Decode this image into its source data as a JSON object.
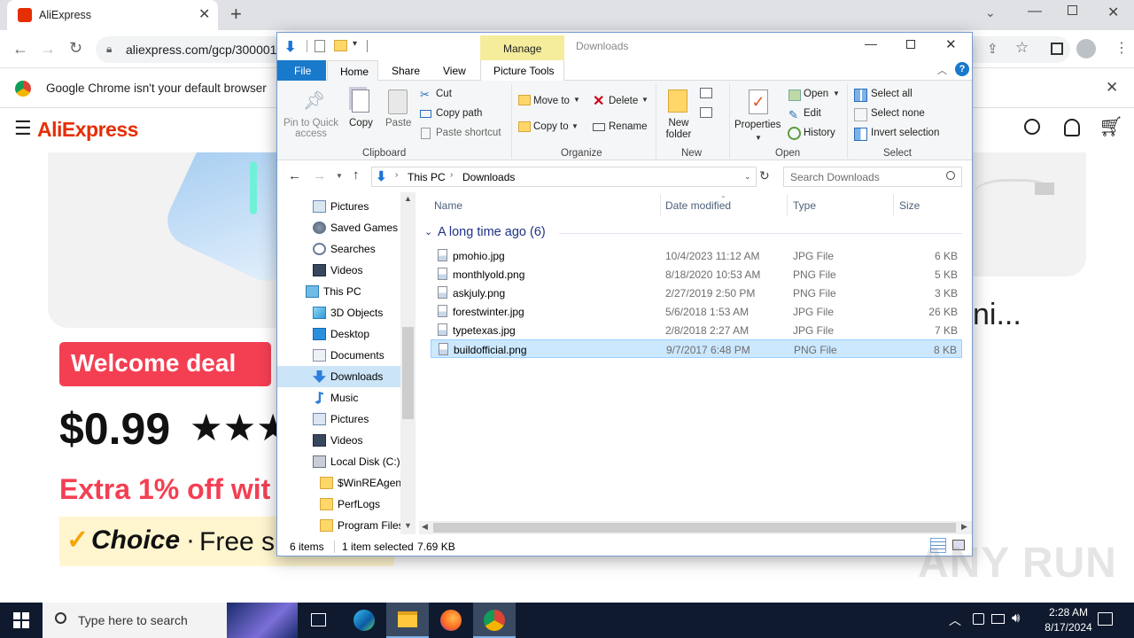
{
  "chrome": {
    "tab_title": "AliExpress",
    "url": "aliexpress.com/gcp/3000015",
    "infobar_text": "Google Chrome isn't your default browser"
  },
  "aliexpress": {
    "logo": "AliExpress",
    "badge": "Welcome deal",
    "price": "$0.99",
    "stars": "★★★",
    "extra": "Extra 1% off wit",
    "choice": "Choice",
    "choice_dot": "·",
    "free": "Free s",
    "title_tail": "ni..."
  },
  "explorer": {
    "title": "Downloads",
    "manage": "Manage",
    "picture_tools": "Picture Tools",
    "tabs": [
      "File",
      "Home",
      "Share",
      "View"
    ],
    "ribbon": {
      "pin": "Pin to Quick access",
      "copy": "Copy",
      "paste": "Paste",
      "cut": "Cut",
      "copy_path": "Copy path",
      "paste_shortcut": "Paste shortcut",
      "move_to": "Move to",
      "copy_to": "Copy to",
      "delete": "Delete",
      "rename": "Rename",
      "new_folder": "New folder",
      "properties": "Properties",
      "open": "Open",
      "edit": "Edit",
      "history": "History",
      "select_all": "Select all",
      "select_none": "Select none",
      "invert_selection": "Invert selection",
      "groups": [
        "Clipboard",
        "Organize",
        "New",
        "Open",
        "Select"
      ]
    },
    "breadcrumb": [
      "This PC",
      "Downloads"
    ],
    "search_placeholder": "Search Downloads",
    "nav": [
      {
        "label": "Pictures",
        "icon": "pictures-icon"
      },
      {
        "label": "Saved Games",
        "icon": "saved-games-icon"
      },
      {
        "label": "Searches",
        "icon": "searches-icon"
      },
      {
        "label": "Videos",
        "icon": "videos-icon"
      },
      {
        "label": "This PC",
        "icon": "this-pc-icon"
      },
      {
        "label": "3D Objects",
        "icon": "3d-objects-icon"
      },
      {
        "label": "Desktop",
        "icon": "desktop-icon"
      },
      {
        "label": "Documents",
        "icon": "documents-icon"
      },
      {
        "label": "Downloads",
        "icon": "downloads-icon"
      },
      {
        "label": "Music",
        "icon": "music-icon"
      },
      {
        "label": "Pictures",
        "icon": "pictures-icon"
      },
      {
        "label": "Videos",
        "icon": "videos-icon"
      },
      {
        "label": "Local Disk (C:)",
        "icon": "local-disk-icon"
      },
      {
        "label": "$WinREAgent",
        "icon": "folder-icon"
      },
      {
        "label": "PerfLogs",
        "icon": "folder-icon"
      },
      {
        "label": "Program Files",
        "icon": "folder-icon"
      }
    ],
    "columns": [
      "Name",
      "Date modified",
      "Type",
      "Size"
    ],
    "group_header": "A long time ago (6)",
    "files": [
      {
        "name": "pmohio.jpg",
        "date": "10/4/2023 11:12 AM",
        "type": "JPG File",
        "size": "6 KB"
      },
      {
        "name": "monthlyold.png",
        "date": "8/18/2020 10:53 AM",
        "type": "PNG File",
        "size": "5 KB"
      },
      {
        "name": "askjuly.png",
        "date": "2/27/2019 2:50 PM",
        "type": "PNG File",
        "size": "3 KB"
      },
      {
        "name": "forestwinter.jpg",
        "date": "5/6/2018 1:53 AM",
        "type": "JPG File",
        "size": "26 KB"
      },
      {
        "name": "typetexas.jpg",
        "date": "2/8/2018 2:27 AM",
        "type": "JPG File",
        "size": "7 KB"
      },
      {
        "name": "buildofficial.png",
        "date": "9/7/2017 6:48 PM",
        "type": "PNG File",
        "size": "8 KB"
      }
    ],
    "status": {
      "items": "6 items",
      "selected": "1 item selected",
      "size": "7.69 KB"
    }
  },
  "taskbar": {
    "search_placeholder": "Type here to search",
    "time": "2:28 AM",
    "date": "8/17/2024"
  },
  "watermark": "ANY RUN"
}
